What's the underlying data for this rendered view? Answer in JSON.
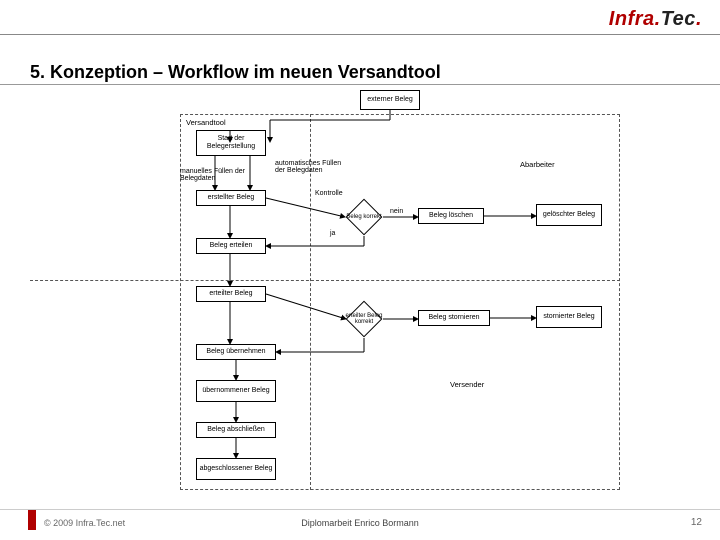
{
  "brand": {
    "part1": "Infra",
    "dot": ".",
    "part2": "Tec"
  },
  "title": "5. Konzeption – Workflow im neuen Versandtool",
  "footer": {
    "copyright": "© 2009 Infra.Tec.net",
    "center": "Diplomarbeit Enrico Bormann",
    "page": "12"
  },
  "diagram": {
    "regions": {
      "tool": "Versandtool",
      "abarbeiter": "Abarbeiter",
      "versender": "Versender"
    },
    "start": "externer\nBeleg",
    "nodes": {
      "n1": "Start der\nBelegerstellung",
      "n2": "erstellter Beleg",
      "n3": "Beleg erteilen",
      "n4": "erteilter Beleg",
      "n5": "Beleg übernehmen",
      "n6": "übernommener\nBeleg",
      "n7": "Beleg abschließen",
      "n8": "abgeschlossener\nBeleg",
      "c1": "Beleg\nkorrekt",
      "c2": "erteilter\nBeleg\nkorrekt",
      "d1": "Beleg löschen",
      "d2": "gelöschter\nBeleg",
      "s1": "Beleg stornieren",
      "s2": "stornierter\nBeleg"
    },
    "edge_labels": {
      "manual": "manuelles Füllen der Belegdaten",
      "auto": "automatisches\nFüllen der Belegdaten",
      "ja1": "Kontrolle",
      "nein": "nein",
      "ja2": "ja"
    }
  }
}
